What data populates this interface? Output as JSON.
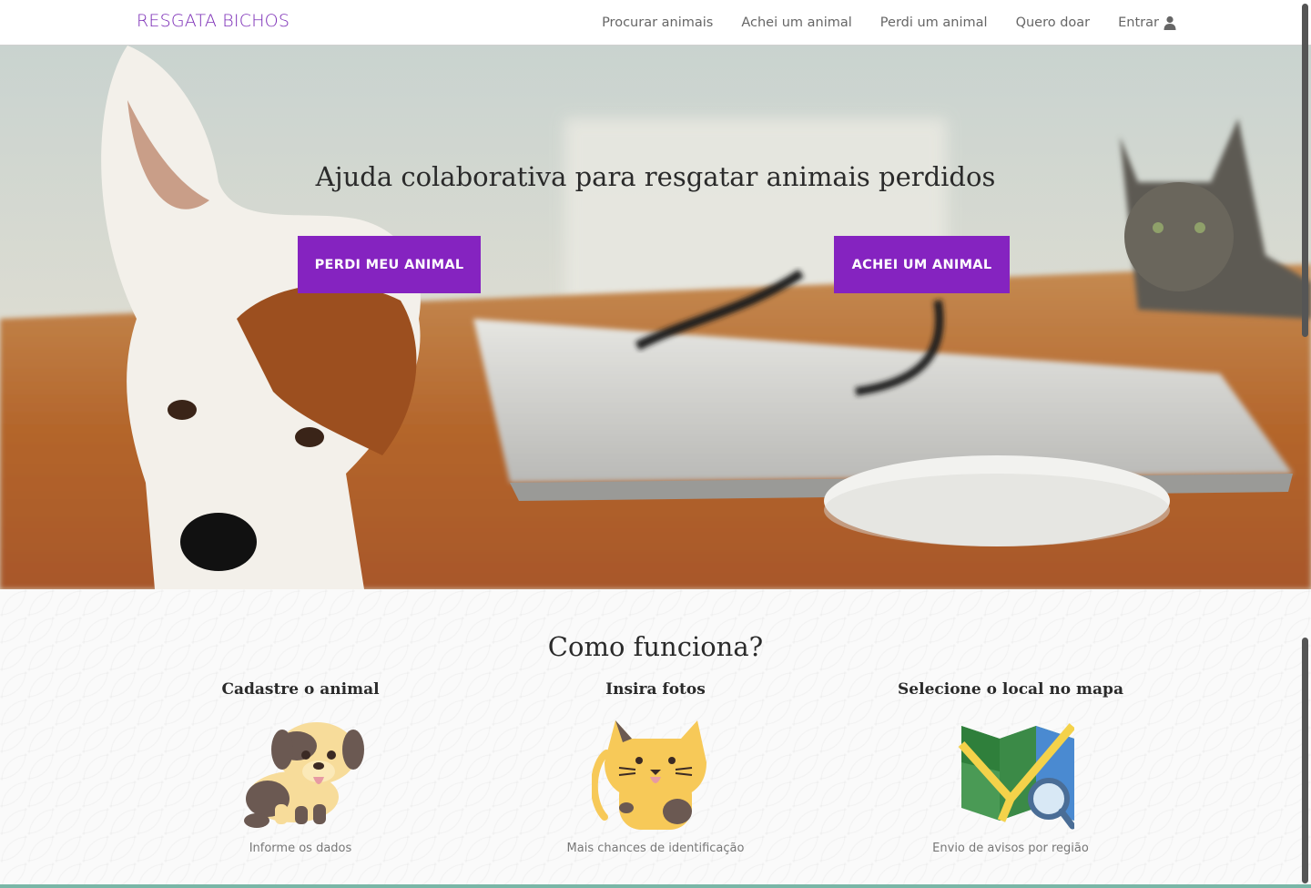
{
  "navbar": {
    "brand": "RESGATA BICHOS",
    "links": [
      {
        "label": "Procurar animais"
      },
      {
        "label": "Achei um animal"
      },
      {
        "label": "Perdi um animal"
      },
      {
        "label": "Quero doar"
      },
      {
        "label": "Entrar",
        "icon": "user-icon"
      }
    ]
  },
  "hero": {
    "title": "Ajuda colaborativa para resgatar animais perdidos",
    "buttons": {
      "lost": "PERDI MEU ANIMAL",
      "found": "ACHEI UM ANIMAL"
    }
  },
  "how_it_works": {
    "title": "Como funciona?",
    "steps": [
      {
        "heading": "Cadastre o animal",
        "icon": "dog-illustration",
        "caption": "Informe os dados"
      },
      {
        "heading": "Insira fotos",
        "icon": "cat-illustration",
        "caption": "Mais chances de identificação"
      },
      {
        "heading": "Selecione o local no mapa",
        "icon": "map-search-illustration",
        "caption": "Envio de avisos por região"
      }
    ]
  },
  "colors": {
    "brand": "#7b2cb6",
    "button": "#8523c0",
    "accent_line": "#79b7a7"
  }
}
